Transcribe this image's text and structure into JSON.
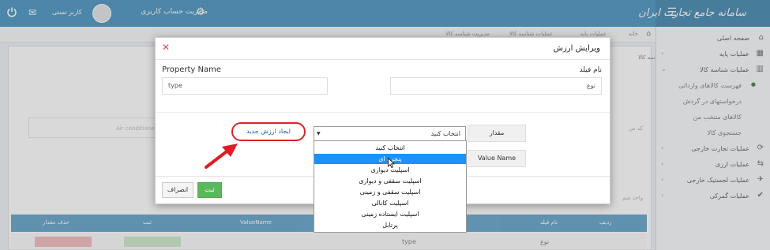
{
  "header": {
    "logo": "سامانه جامع تجارت ایران",
    "account_management": "مدیریت حساب کاربری",
    "user_name": "کاربر تستی"
  },
  "sidebar": {
    "items": [
      {
        "label": "صفحه اصلی"
      },
      {
        "label": "عملیات پایه"
      },
      {
        "label": "عملیات شناسه کالا"
      },
      {
        "label": "فهرست کالاهای وارداتی"
      },
      {
        "label": "درخواستهای در گردش"
      },
      {
        "label": "کالاهای منتخب من"
      },
      {
        "label": "جستجوی کالا"
      },
      {
        "label": "عملیات تجارت خارجی"
      },
      {
        "label": "عملیات ارزی"
      },
      {
        "label": "عملیات لجستیک خارجی"
      },
      {
        "label": "عملیات گمرکی"
      }
    ]
  },
  "breadcrumb": [
    "خانه",
    "عملیات پایه",
    "عملیات شناسه کالا",
    "مدیریت شناسه کالا"
  ],
  "background": {
    "tab_label": "شناسه کالا",
    "code_label": "کد س",
    "code_value": "Air conditioner",
    "unit_label": "واحد شم",
    "table_headers": [
      "ردیف",
      "نام فیلد",
      "ValueName",
      "ثبت",
      "حذف مقدار"
    ],
    "row": {
      "name": "نوع",
      "type": "type"
    }
  },
  "modal": {
    "title": "ویرایش ارزش",
    "close": "✕",
    "field_name_label": "نام فیلد",
    "field_name_value": "نوع",
    "property_name_label": "Property Name",
    "property_name_value": "type",
    "value_label": "مقدار",
    "value_name_label": "Value Name",
    "select_value": "انتخاب کنید",
    "create_button": "ایجاد ارزش جدید",
    "save_button": "ثبت",
    "cancel_button": "انصراف",
    "options": [
      "انتخاب کنید",
      "پنجره ای",
      "اسپلیت دیواری",
      "اسپلیت سقفی و دیواری",
      "اسپلیت سقفی و زمینی",
      "اسپلیت کانالی",
      "اسپلیت ایستاده زمینی",
      "پرتابل"
    ],
    "selected_option_index": 1
  },
  "colors": {
    "header": "#3c8dbc",
    "accent_red": "#d9242b",
    "save_green": "#5cb85c",
    "highlight_blue": "#1e90ff"
  }
}
